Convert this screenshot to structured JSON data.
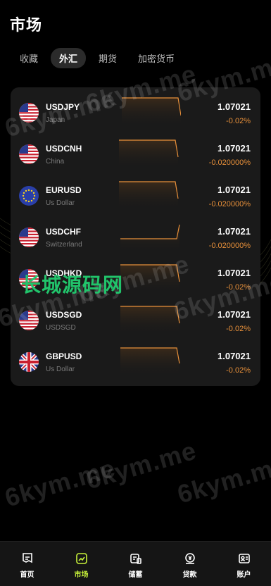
{
  "page": {
    "title": "市场"
  },
  "tabs": [
    {
      "label": "收藏",
      "active": false
    },
    {
      "label": "外汇",
      "active": true
    },
    {
      "label": "期货",
      "active": false
    },
    {
      "label": "加密货币",
      "active": false
    }
  ],
  "market": {
    "rows": [
      {
        "symbol": "USDJPY",
        "sub": "Japan",
        "flag": "us-flag-icon",
        "price": "1.07021",
        "change": "-0.02%"
      },
      {
        "symbol": "USDCNH",
        "sub": "China",
        "flag": "us-flag-icon",
        "price": "1.07021",
        "change": "-0.020000%"
      },
      {
        "symbol": "EURUSD",
        "sub": "Us Dollar",
        "flag": "eu-flag-icon",
        "price": "1.07021",
        "change": "-0.020000%"
      },
      {
        "symbol": "USDCHF",
        "sub": "Switzerland",
        "flag": "us-flag-icon",
        "price": "1.07021",
        "change": "-0.020000%"
      },
      {
        "symbol": "USDHKD",
        "sub": "",
        "flag": "us-flag-icon",
        "price": "1.07021",
        "change": "-0.02%"
      },
      {
        "symbol": "USDSGD",
        "sub": "USDSGD",
        "flag": "us-flag-icon",
        "price": "1.07021",
        "change": "-0.02%"
      },
      {
        "symbol": "GBPUSD",
        "sub": "Us Dollar",
        "flag": "uk-flag-icon",
        "price": "1.07021",
        "change": "-0.02%"
      }
    ]
  },
  "watermarks": {
    "text": "6kym.me",
    "overlay": "长城源码网"
  },
  "nav": [
    {
      "label": "首页",
      "icon": "home-icon",
      "active": false
    },
    {
      "label": "市场",
      "icon": "market-icon",
      "active": true
    },
    {
      "label": "储蓄",
      "icon": "savings-icon",
      "active": false
    },
    {
      "label": "贷款",
      "icon": "loan-icon",
      "active": false
    },
    {
      "label": "账户",
      "icon": "account-icon",
      "active": false
    }
  ],
  "colors": {
    "accent": "#c8f23a",
    "negative": "#e8903a",
    "card": "#1a1a1a",
    "background": "#000000",
    "watermark_green": "#21c46b"
  }
}
